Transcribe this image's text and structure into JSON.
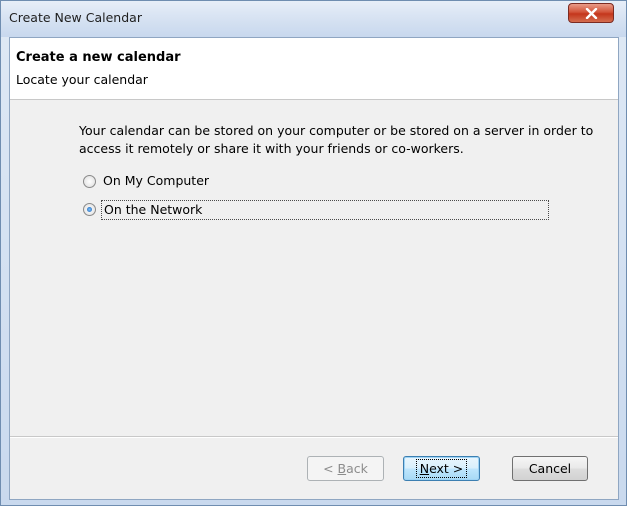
{
  "window": {
    "title": "Create New Calendar",
    "close_label": "X"
  },
  "header": {
    "title": "Create a new calendar",
    "subtitle": "Locate your calendar"
  },
  "content": {
    "description": "Your calendar can be stored on your computer or be stored on a server in order to access it remotely or share it with your friends or co-workers.",
    "options": [
      {
        "label": "On My Computer",
        "selected": false
      },
      {
        "label": "On the Network",
        "selected": true
      }
    ]
  },
  "buttons": {
    "back": {
      "prefix": "< ",
      "mnemonic": "B",
      "rest": "ack",
      "enabled": false
    },
    "next": {
      "mnemonic": "N",
      "rest": "ext >",
      "enabled": true
    },
    "cancel": {
      "label": "Cancel",
      "enabled": true
    }
  },
  "colors": {
    "accent": "#3c7fb1",
    "close_button": "#c4361c"
  }
}
